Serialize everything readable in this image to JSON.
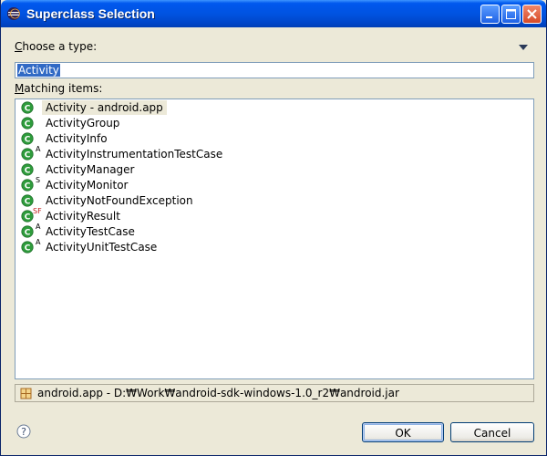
{
  "window": {
    "title": "Superclass Selection"
  },
  "choose": {
    "label_accel": "C",
    "label_rest": "hoose a type:",
    "value": "Activity"
  },
  "matching": {
    "label_accel": "M",
    "label_rest": "atching items:"
  },
  "items": [
    {
      "label": "Activity - android.app",
      "badge": ""
    },
    {
      "label": "ActivityGroup",
      "badge": ""
    },
    {
      "label": "ActivityInfo",
      "badge": ""
    },
    {
      "label": "ActivityInstrumentationTestCase",
      "badge": "A"
    },
    {
      "label": "ActivityManager",
      "badge": ""
    },
    {
      "label": "ActivityMonitor",
      "badge": "S"
    },
    {
      "label": "ActivityNotFoundException",
      "badge": ""
    },
    {
      "label": "ActivityResult",
      "badge": "SF"
    },
    {
      "label": "ActivityTestCase",
      "badge": "A"
    },
    {
      "label": "ActivityUnitTestCase",
      "badge": "A"
    }
  ],
  "status": {
    "text": "android.app - D:₩Work₩android-sdk-windows-1.0_r2₩android.jar"
  },
  "buttons": {
    "ok": "OK",
    "cancel": "Cancel"
  },
  "icons": {
    "title": "eclipse-icon",
    "class": "class-icon",
    "package": "package-icon",
    "help": "help-icon"
  },
  "colors": {
    "class_icon": "#2e9c3c",
    "selection": "#316ac5",
    "titlebar": "#0058ee"
  }
}
